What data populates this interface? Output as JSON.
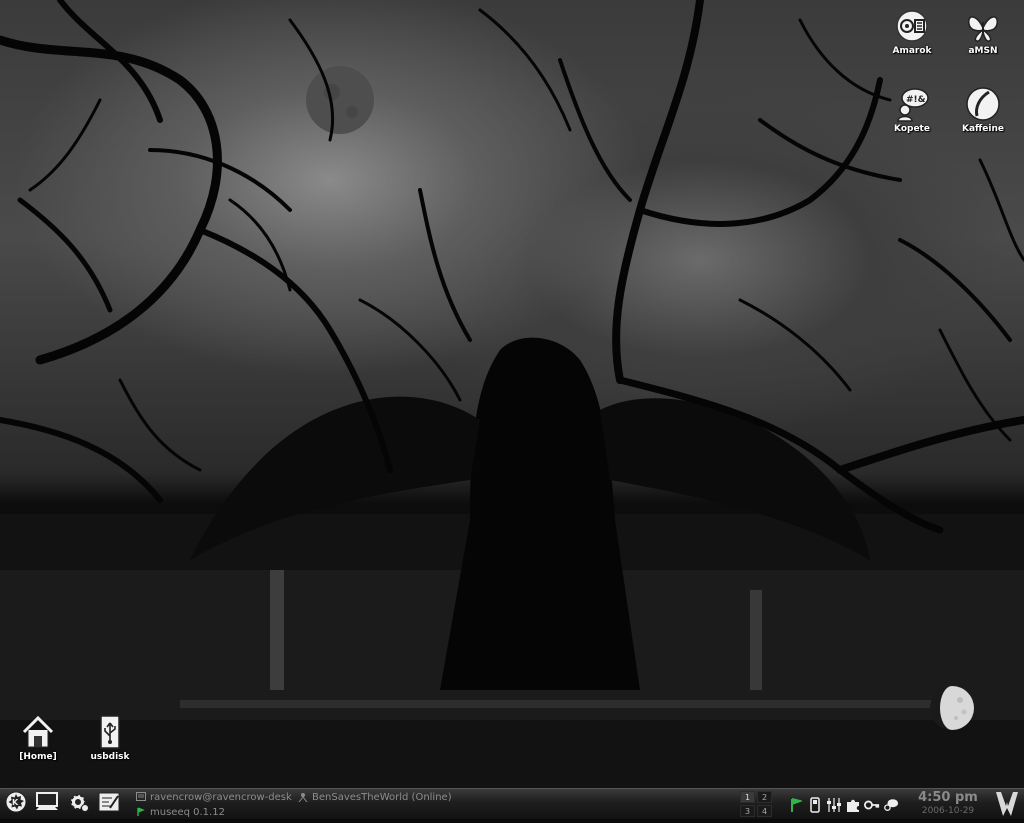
{
  "desktop": {
    "icons_top_right": [
      {
        "id": "amarok",
        "label": "Amarok",
        "icon": "speaker-icon"
      },
      {
        "id": "amsn",
        "label": "aMSN",
        "icon": "butterfly-icon"
      },
      {
        "id": "kopete",
        "label": "Kopete",
        "icon": "chat-icon"
      },
      {
        "id": "kaffeine",
        "label": "Kaffeine",
        "icon": "disc-icon"
      }
    ],
    "icons_bottom_left": [
      {
        "id": "home",
        "label": "[Home]",
        "icon": "house-icon"
      },
      {
        "id": "usbdisk",
        "label": "usbdisk",
        "icon": "usb-icon"
      }
    ],
    "moon_applet": {
      "icon": "moon-phase-icon"
    }
  },
  "taskbar": {
    "launchers": [
      {
        "id": "kmenu",
        "icon": "kde-menu-icon"
      },
      {
        "id": "desktop",
        "icon": "show-desktop-icon"
      },
      {
        "id": "settings",
        "icon": "gear-icon"
      },
      {
        "id": "notes",
        "icon": "notes-icon"
      }
    ],
    "tasks": [
      {
        "label": "ravencrow@ravencrow-desk",
        "icon": "terminal-icon"
      },
      {
        "label": "BenSavesTheWorld (Online)",
        "icon": "person-icon"
      },
      {
        "label": "museeq 0.1.12",
        "icon": "museeq-icon"
      }
    ],
    "pager": {
      "desktops": [
        "1",
        "2",
        "3",
        "4"
      ],
      "active": "1"
    },
    "tray": [
      "flag-icon",
      "phone-icon",
      "mixer-icon",
      "puzzle-icon",
      "key-icon",
      "chat-icon"
    ],
    "clock": {
      "time": "4:50 pm",
      "date": "2006-10-29"
    },
    "logo": {
      "icon": "crow-logo-icon"
    },
    "colors": {
      "bar": "#1e1e1e",
      "clock": "#8a8a8a",
      "accent": "#2db54a"
    }
  }
}
